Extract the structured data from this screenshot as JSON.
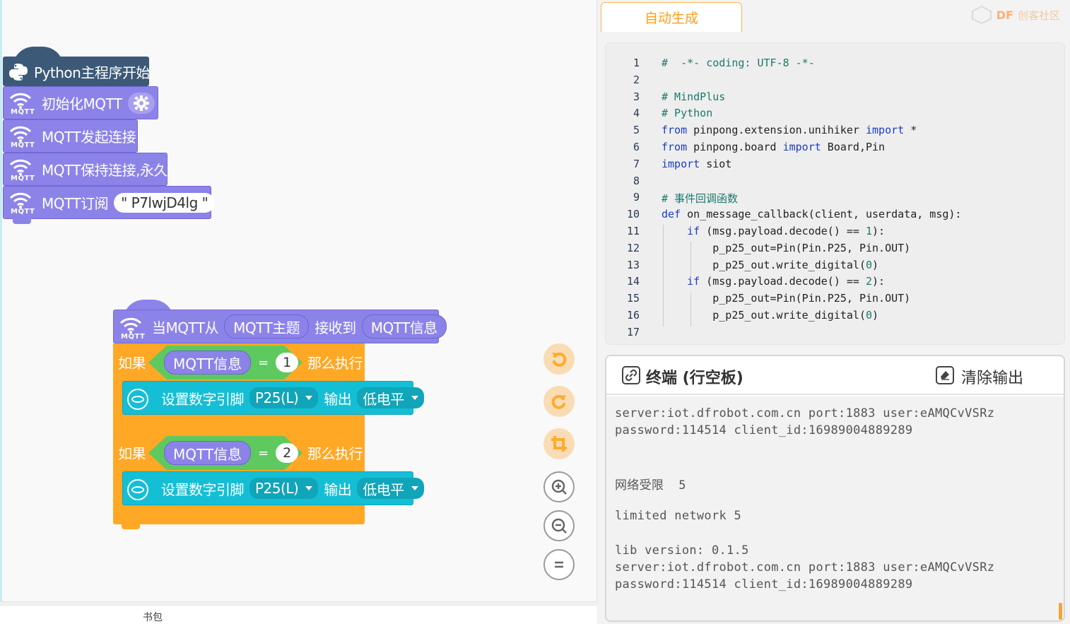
{
  "blocks": {
    "main_start": "Python主程序开始",
    "init_mqtt": "初始化MQTT",
    "mqtt_connect": "MQTT发起连接",
    "mqtt_keep": "MQTT保持连接,永久",
    "mqtt_subscribe": "MQTT订阅",
    "subscribe_topic": "\" P7lwjD4lg \"",
    "mqtt_tag": "MQTT",
    "event_when": "当MQTT从",
    "event_topic": "MQTT主题",
    "event_received": "接收到",
    "event_message": "MQTT信息",
    "if1": {
      "label": "如果",
      "var": "MQTT信息",
      "op": "=",
      "value": "1",
      "then": "那么执行"
    },
    "set1": {
      "label": "设置数字引脚",
      "pin": "P25(L)",
      "output": "输出",
      "level": "低电平"
    },
    "if2": {
      "label": "如果",
      "var": "MQTT信息",
      "op": "=",
      "value": "2",
      "then": "那么执行"
    },
    "set2": {
      "label": "设置数字引脚",
      "pin": "P25(L)",
      "output": "输出",
      "level": "低电平"
    }
  },
  "backpack_label": "书包",
  "tabs": {
    "auto_generate": "自动生成"
  },
  "logo": {
    "brand": "DF",
    "text": "创客社区"
  },
  "code_lines": [
    {
      "n": "1",
      "parts": [
        [
          "cm",
          "#  -*- coding: UTF-8 -*-"
        ]
      ]
    },
    {
      "n": "2",
      "parts": []
    },
    {
      "n": "3",
      "parts": [
        [
          "cm",
          "# MindPlus"
        ]
      ]
    },
    {
      "n": "4",
      "parts": [
        [
          "cm",
          "# Python"
        ]
      ]
    },
    {
      "n": "5",
      "parts": [
        [
          "kw",
          "from"
        ],
        [
          "tx",
          " pinpong.extension.unihiker "
        ],
        [
          "kw",
          "import"
        ],
        [
          "tx",
          " *"
        ]
      ]
    },
    {
      "n": "6",
      "parts": [
        [
          "kw",
          "from"
        ],
        [
          "tx",
          " pinpong.board "
        ],
        [
          "kw",
          "import"
        ],
        [
          "tx",
          " Board,Pin"
        ]
      ]
    },
    {
      "n": "7",
      "parts": [
        [
          "kw",
          "import"
        ],
        [
          "tx",
          " siot"
        ]
      ]
    },
    {
      "n": "8",
      "parts": []
    },
    {
      "n": "9",
      "parts": [
        [
          "cm",
          "# 事件回调函数"
        ]
      ]
    },
    {
      "n": "10",
      "parts": [
        [
          "kw",
          "def"
        ],
        [
          "tx",
          " on_message_callback(client, userdata, msg):"
        ]
      ]
    },
    {
      "n": "11",
      "parts": [
        [
          "tx",
          "    "
        ],
        [
          "kw",
          "if"
        ],
        [
          "tx",
          " (msg.payload.decode() == "
        ],
        [
          "nm",
          "1"
        ],
        [
          "tx",
          "):"
        ]
      ]
    },
    {
      "n": "12",
      "parts": [
        [
          "tx",
          "        p_p25_out=Pin(Pin.P25, Pin.OUT)"
        ]
      ]
    },
    {
      "n": "13",
      "parts": [
        [
          "tx",
          "        p_p25_out.write_digital("
        ],
        [
          "nm",
          "0"
        ],
        [
          "tx",
          ")"
        ]
      ]
    },
    {
      "n": "14",
      "parts": [
        [
          "tx",
          "    "
        ],
        [
          "kw",
          "if"
        ],
        [
          "tx",
          " (msg.payload.decode() == "
        ],
        [
          "nm",
          "2"
        ],
        [
          "tx",
          "):"
        ]
      ]
    },
    {
      "n": "15",
      "parts": [
        [
          "tx",
          "        p_p25_out=Pin(Pin.P25, Pin.OUT)"
        ]
      ]
    },
    {
      "n": "16",
      "parts": [
        [
          "tx",
          "        p_p25_out.write_digital("
        ],
        [
          "nm",
          "0"
        ],
        [
          "tx",
          ")"
        ]
      ]
    },
    {
      "n": "17",
      "parts": []
    }
  ],
  "terminal": {
    "title": "终端 (行空板)",
    "clear": "清除输出",
    "lines": [
      "server:iot.dfrobot.com.cn port:1883 user:eAMQCvVSRz",
      "password:114514 client_id:16989004889289",
      "",
      "",
      "网络受限  5",
      "",
      "limited network 5",
      "",
      "lib version: 0.1.5",
      "server:iot.dfrobot.com.cn port:1883 user:eAMQCvVSRz",
      "password:114514 client_id:16989004889289"
    ]
  },
  "colors": {
    "mqtt_block": "#8c83e9",
    "control_block": "#ffa825",
    "pin_block": "#14bfd6",
    "operator_block": "#5ec95e",
    "keyword": "#1b3cc7",
    "comment": "#1a7a6c",
    "tab_accent": "#ff9f1a"
  },
  "tools": [
    "undo-icon",
    "redo-icon",
    "crop-icon",
    "zoom-in-icon",
    "zoom-out-icon",
    "reset-zoom-icon"
  ]
}
